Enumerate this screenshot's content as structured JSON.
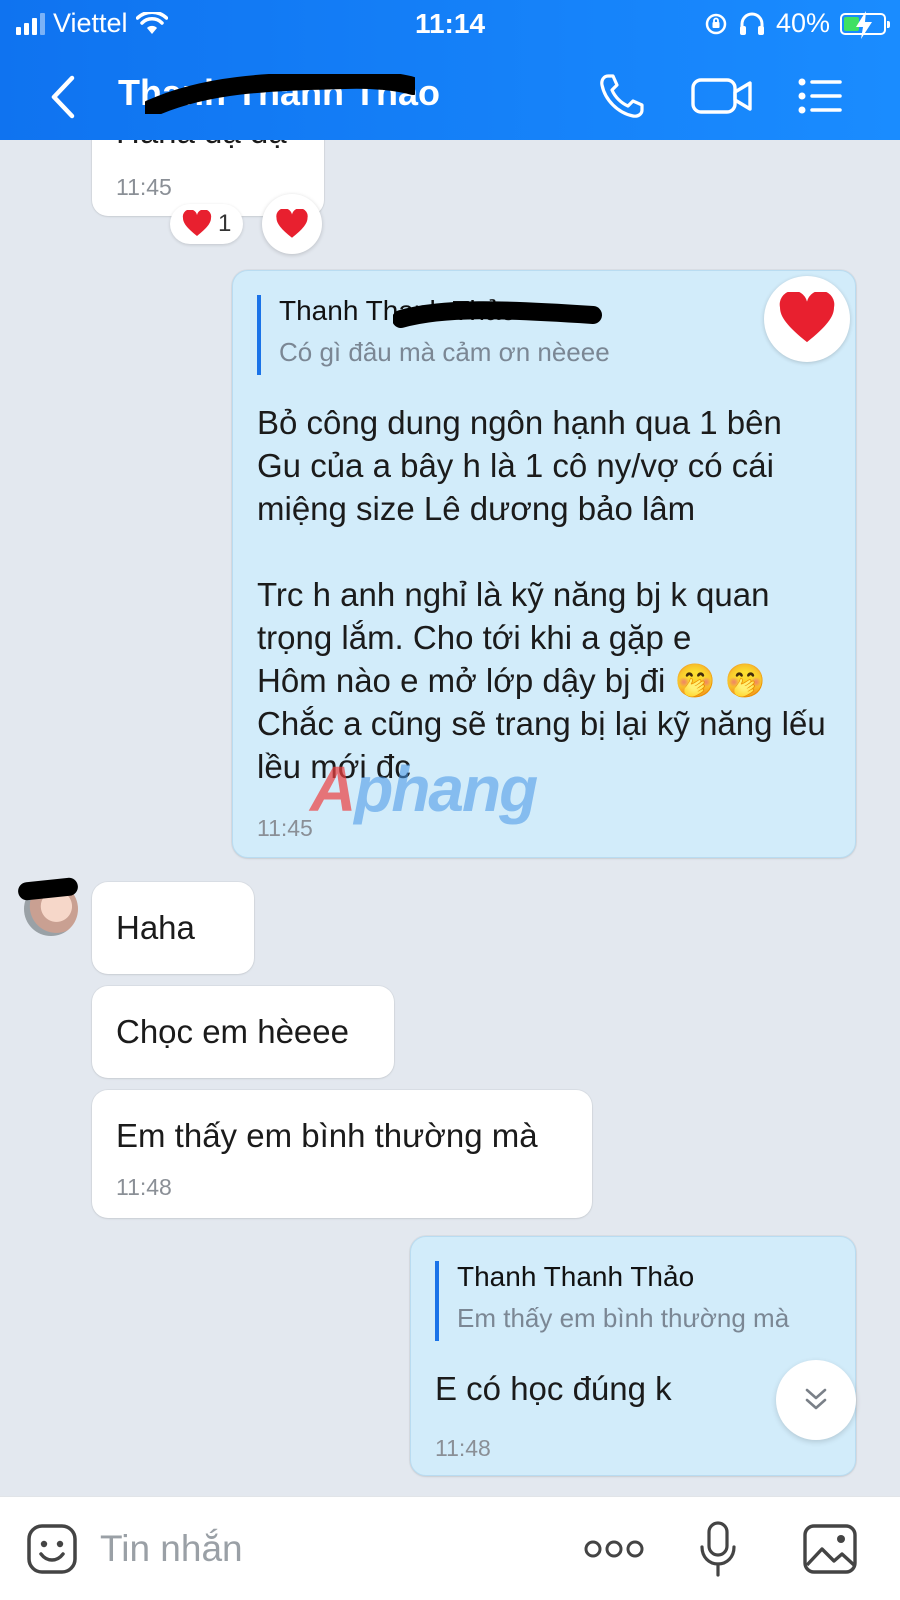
{
  "status_bar": {
    "carrier": "Viettel",
    "time": "11:14",
    "battery": "40%",
    "battery_level": 0.4,
    "icons": [
      "signal-icon",
      "wifi-icon",
      "orientation-lock-icon",
      "headphones-icon",
      "battery-charging-icon"
    ]
  },
  "header": {
    "contact_name": "Thanh Thanh Thảo",
    "icons": [
      "back-icon",
      "phone-icon",
      "video-call-icon",
      "menu-icon"
    ]
  },
  "messages": [
    {
      "id": "m1",
      "sender": "contact",
      "text": "Haha dạ dạ",
      "time": "11:45",
      "reaction_count": "1"
    },
    {
      "id": "m2",
      "sender": "me",
      "quote_name": "Thanh Thanh Thảo",
      "quote_text": "Có gì đâu mà cảm ơn nèeee",
      "text": "Bỏ công dung ngôn hạnh qua 1 bên\nGu của a bây h là 1 cô ny/vợ có cái miệng size Lê dương bảo lâm\n\nTrc h anh nghỉ là kỹ năng bj k quan trọng lắm. Cho tới khi a gặp e\nHôm nào e mở lớp dậy bj đi 🤭 🤭\nChắc a cũng sẽ trang bị lại kỹ năng lếu lều mới đc",
      "time": "11:45"
    },
    {
      "id": "m3",
      "sender": "contact",
      "text": "Haha"
    },
    {
      "id": "m4",
      "sender": "contact",
      "text": "Chọc em hèeee"
    },
    {
      "id": "m5",
      "sender": "contact",
      "text": "Em thấy em bình thường mà",
      "time": "11:48"
    },
    {
      "id": "m6",
      "sender": "me",
      "quote_name": "Thanh Thanh Thảo",
      "quote_text": "Em thấy em bình thường mà",
      "text": "E có học đúng k",
      "time": "11:48"
    }
  ],
  "watermark": {
    "part1": "A",
    "part2": "phang"
  },
  "input_bar": {
    "placeholder": "Tin nhắn",
    "icons": [
      "emoji-icon",
      "more-icon",
      "microphone-icon",
      "image-icon"
    ]
  },
  "colors": {
    "header": "#0f73f0",
    "my_bubble": "#d2ecfa",
    "contact_bubble": "#ffffff",
    "background": "#e3e8ef",
    "reaction": "#e8202f"
  }
}
